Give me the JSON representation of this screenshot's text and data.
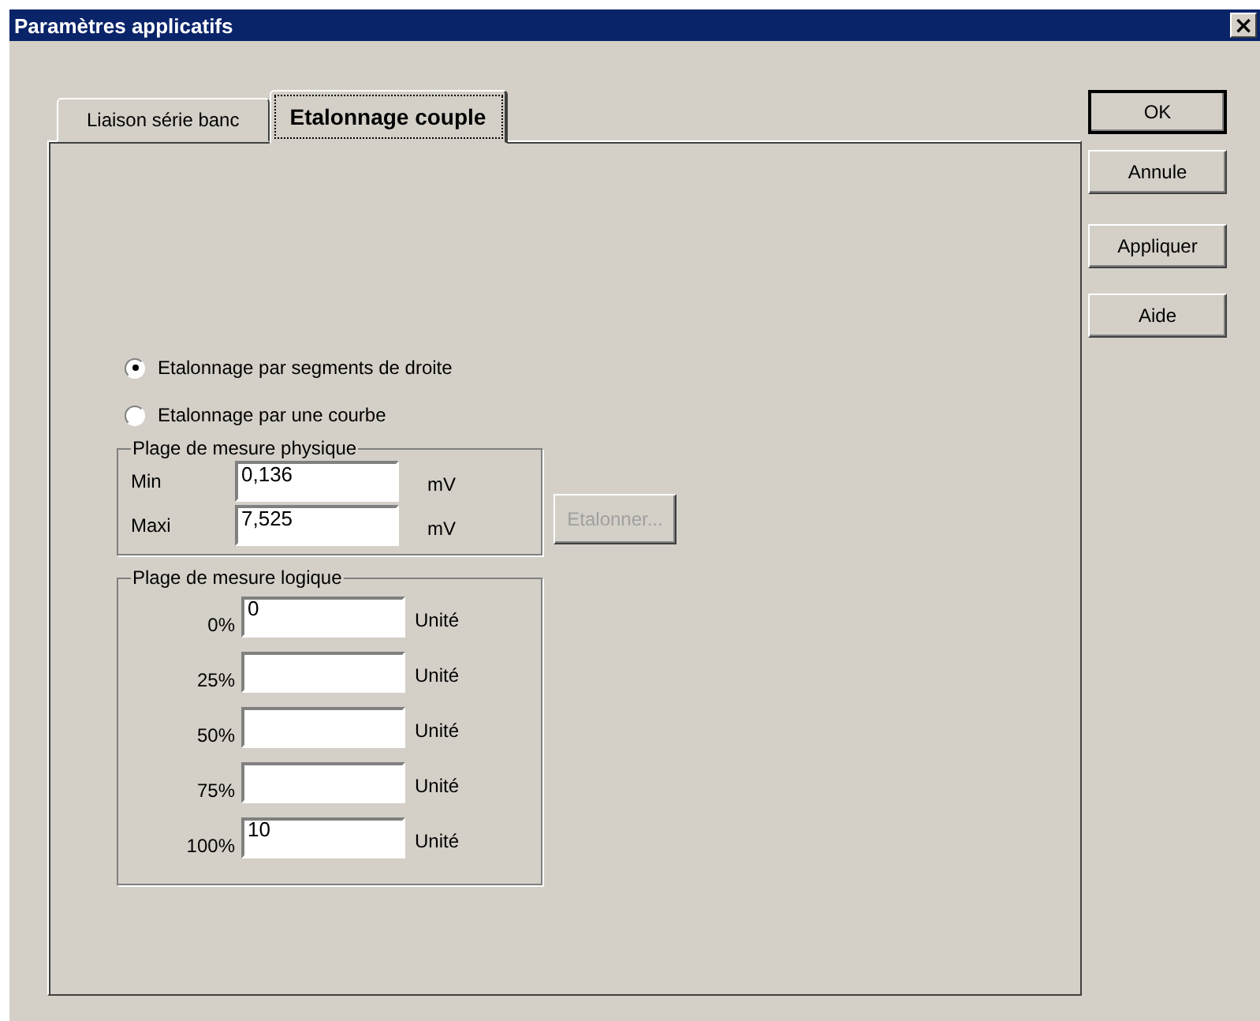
{
  "window": {
    "title": "Paramètres applicatifs",
    "close": "×"
  },
  "tabs": [
    {
      "label": "Liaison série banc",
      "selected": false
    },
    {
      "label": "Etalonnage couple",
      "selected": true
    }
  ],
  "options": [
    {
      "label": "Etalonnage par segments de droite",
      "selected": true
    },
    {
      "label": "Etalonnage par une courbe",
      "selected": false
    }
  ],
  "physical_range": {
    "title": "Plage de mesure physique",
    "fields": [
      {
        "label": "Min",
        "value": "0,136",
        "unit": "mV"
      },
      {
        "label": "Maxi",
        "value": "7,525",
        "unit": "mV"
      }
    ]
  },
  "calibrate_button": {
    "label": "Etalonner...",
    "disabled": true
  },
  "logical_range": {
    "title": "Plage de mesure logique",
    "fields": [
      {
        "label": "0%",
        "value": "0",
        "unit": "Unité"
      },
      {
        "label": "25%",
        "unit": "Unité"
      },
      {
        "label": "50%",
        "unit": "Unité"
      },
      {
        "label": "75%",
        "unit": "Unité"
      },
      {
        "label": "100%",
        "value": "10",
        "unit": "Unité"
      }
    ]
  },
  "buttons": [
    {
      "label": "OK",
      "default": true
    },
    {
      "label": "Annule",
      "default": false
    },
    {
      "label": "Appliquer",
      "default": false
    },
    {
      "label": "Aide",
      "default": false
    }
  ]
}
